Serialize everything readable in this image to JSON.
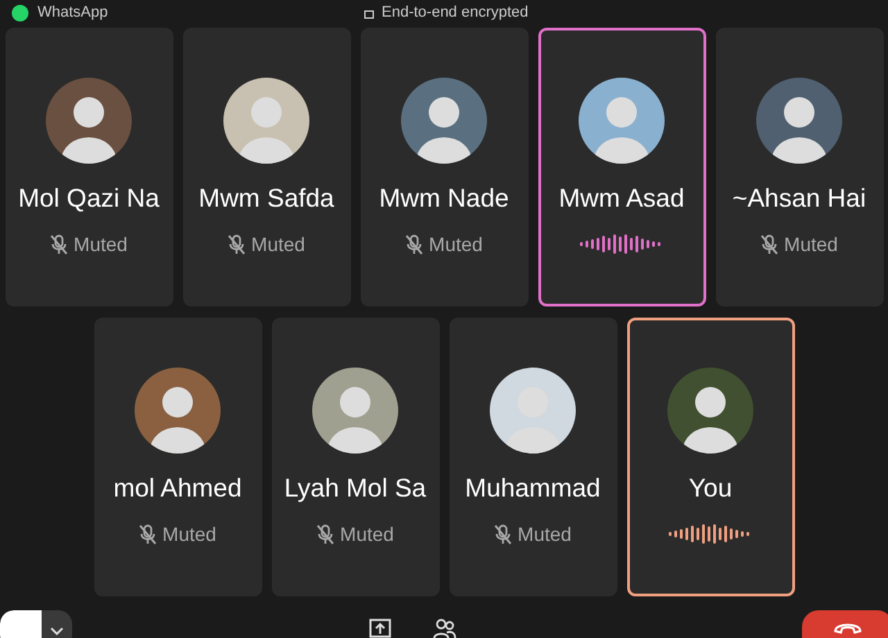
{
  "title_bar": {
    "app": "WhatsApp",
    "encryption": "End-to-end encrypted"
  },
  "rows": [
    [
      {
        "name": "Mol Qazi Na",
        "kind": "muted",
        "status": "Muted"
      },
      {
        "name": "Mwm Safda",
        "kind": "muted",
        "status": "Muted"
      },
      {
        "name": "Mwm Nade",
        "kind": "muted",
        "status": "Muted"
      },
      {
        "name": "Mwm Asad",
        "kind": "speaking",
        "color": "#e070c8"
      },
      {
        "name": "~Ahsan Hai",
        "kind": "muted",
        "status": "Muted"
      }
    ],
    [
      {
        "name": "mol Ahmed",
        "kind": "muted",
        "status": "Muted"
      },
      {
        "name": "Lyah Mol Sa",
        "kind": "muted",
        "status": "Muted"
      },
      {
        "name": "Muhammad",
        "kind": "muted",
        "status": "Muted"
      },
      {
        "name": "You",
        "kind": "speaking",
        "color": "#f0a080"
      }
    ]
  ]
}
